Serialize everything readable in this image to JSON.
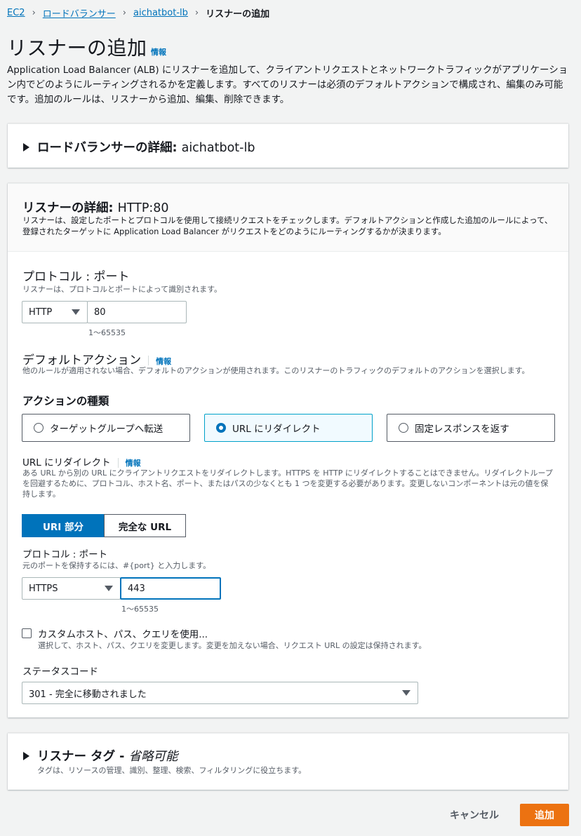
{
  "breadcrumb": {
    "items": [
      "EC2",
      "ロードバランサー",
      "aichatbot-lb"
    ],
    "current": "リスナーの追加",
    "separator": "›"
  },
  "header": {
    "title": "リスナーの追加",
    "info": "情報",
    "description": "Application Load Balancer (ALB) にリスナーを追加して、クライアントリクエストとネットワークトラフィックがアプリケーション内でどのようにルーティングされるかを定義します。すべてのリスナーは必須のデフォルトアクションで構成され、編集のみ可能です。追加のルールは、リスナーから追加、編集、削除できます。"
  },
  "lb_details": {
    "label": "ロードバランサーの詳細:",
    "name": "aichatbot-lb"
  },
  "listener": {
    "title_label": "リスナーの詳細:",
    "title_value": "HTTP:80",
    "description": "リスナーは、設定したポートとプロトコルを使用して接続リクエストをチェックします。デフォルトアクションと作成した追加のルールによって、登録されたターゲットに Application Load Balancer がリクエストをどのようにルーティングするかが決まります。",
    "protocol_port_label": "プロトコル : ポート",
    "protocol_port_desc": "リスナーは、プロトコルとポートによって識別されます。",
    "protocol": "HTTP",
    "port": "80",
    "port_range": "1〜65535",
    "default_action_label": "デフォルトアクション",
    "default_action_info": "情報",
    "default_action_desc": "他のルールが適用されない場合、デフォルトのアクションが使用されます。このリスナーのトラフィックのデフォルトのアクションを選択します。",
    "action_type_label": "アクションの種類",
    "actions": [
      {
        "label": "ターゲットグループへ転送",
        "selected": false
      },
      {
        "label": "URL にリダイレクト",
        "selected": true
      },
      {
        "label": "固定レスポンスを返す",
        "selected": false
      }
    ]
  },
  "redirect": {
    "label": "URL にリダイレクト",
    "info": "情報",
    "description": "ある URL から別の URL にクライアントリクエストをリダイレクトします。HTTPS を HTTP にリダイレクトすることはできません。リダイレクトループを回避するために、プロトコル、ホスト名、ポート、またはパスの少なくとも 1 つを変更する必要があります。変更しないコンポーネントは元の値を保持します。",
    "seg_uri": "URI 部分",
    "seg_full": "完全な URL",
    "protocol_port_label": "プロトコル : ポート",
    "protocol_port_desc": "元のポートを保持するには、#{port} と入力します。",
    "protocol": "HTTPS",
    "port": "443",
    "port_range": "1〜65535",
    "custom_label": "カスタムホスト、パス、クエリを使用...",
    "custom_desc": "選択して、ホスト、パス、クエリを変更します。変更を加えない場合、リクエスト URL の設定は保持されます。",
    "status_code_label": "ステータスコード",
    "status_code": "301 - 完全に移動されました"
  },
  "tags": {
    "title": "リスナー タグ",
    "dash": " - ",
    "optional": "省略可能",
    "description": "タグは、リソースの管理、識別、整理、検索、フィルタリングに役立ちます。"
  },
  "footer": {
    "cancel": "キャンセル",
    "add": "追加"
  },
  "colors": {
    "primary": "#ec7211",
    "link": "#0073bb",
    "selected_bg": "#f1faff"
  }
}
